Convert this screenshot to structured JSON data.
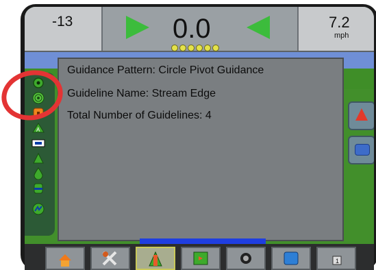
{
  "lightbar": {
    "cross_track": "-13",
    "center_value": "0.0",
    "speed": "7.2",
    "speed_unit": "mph",
    "led_count": 6
  },
  "info_panel": {
    "guidance_pattern": "Guidance Pattern: Circle Pivot Guidance",
    "guideline_name": "Guideline Name: Stream Edge",
    "total_guidelines": "Total Number of Guidelines: 4"
  },
  "left_rail": {
    "icons": [
      "guidance-pattern-icon",
      "circle-pivot-icon",
      "lock-icon",
      "mark-a-icon",
      "implement-icon",
      "fan-icon",
      "drop-icon",
      "tank-icon",
      "swath-icon"
    ]
  },
  "right_side": {
    "icons": [
      "compass-icon",
      "chat-icon"
    ]
  },
  "bottom_nav": {
    "tabs": [
      "home-icon",
      "tools-icon",
      "guidance-icon",
      "map-icon",
      "camera-icon",
      "data-icon",
      "lock-status-icon"
    ],
    "active_tab": "guidance-icon"
  },
  "colors": {
    "highlight_ring": "#e33434",
    "led": "#e4e24a",
    "arrow": "#3cbc3c",
    "field": "#3f8e28",
    "panel": "#7a7e81"
  }
}
